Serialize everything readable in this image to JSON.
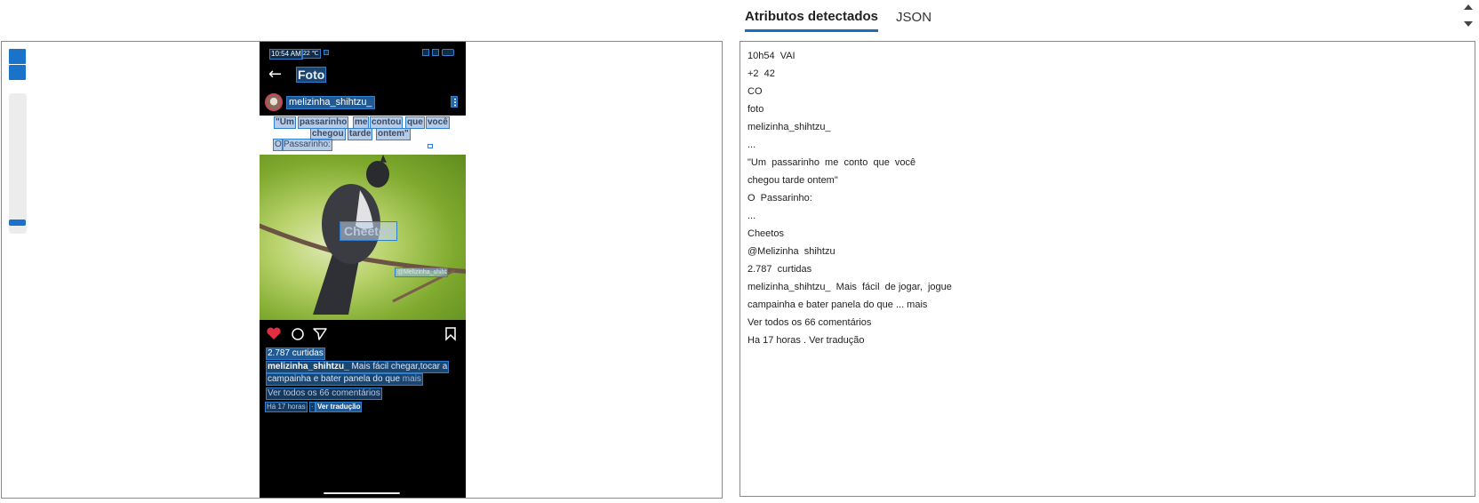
{
  "tabs": [
    {
      "label": "Atributos detectados",
      "active": true
    },
    {
      "label": "JSON",
      "active": false
    }
  ],
  "phone": {
    "status_time": "10:54 AM",
    "status_extra": "22 ℃",
    "header_title": "Foto",
    "username": "melizinha_shihtzu_",
    "caption_words_line1": [
      "\"Um",
      "passarinho",
      "me",
      "contou",
      "que",
      "você"
    ],
    "caption_words_line2": [
      "chegou",
      "tarde",
      "ontem\""
    ],
    "caption_signature_o": "O",
    "caption_signature": "Passarinho:",
    "photo_label": "Cheetos",
    "photo_tag": "@Melizinha_shihtzu",
    "likes": "2.787 curtidas",
    "desc_user": "melizinha_shihtzu_",
    "desc_text_1": "Mais fácil chegar,tocar a",
    "desc_text_2": "campainha e bater panela do que",
    "desc_more": "mais",
    "view_comments": "Ver todos os 66 comentários",
    "time_ago": "Há 17 horas",
    "dot": "·",
    "see_translation": "Ver tradução"
  },
  "attributes": [
    "10h54  VAI",
    "+2  42",
    "CO",
    "foto",
    "melizinha_shihtzu_",
    "...",
    "\"Um  passarinho  me  conto  que  você",
    "chegou tarde ontem\"",
    "O  Passarinho:",
    "...",
    "Cheetos",
    "@Melizinha  shihtzu",
    "2.787  curtidas",
    "melizinha_shihtzu_  Mais  fácil  de jogar,  jogue",
    "campainha e bater panela do que ... mais",
    "Ver todos os 66 comentários",
    "Ha 17 horas . Ver tradução"
  ],
  "colors": {
    "accent": "#1a73c8",
    "tab_underline": "#1a6fb8",
    "heart": "#e0303f"
  },
  "icons": [
    "zoom-in-icon",
    "zoom-out-icon",
    "back-arrow-icon",
    "more-options-icon",
    "heart-icon",
    "comment-icon",
    "share-icon",
    "bookmark-icon",
    "scroll-up-icon",
    "scroll-down-icon"
  ]
}
